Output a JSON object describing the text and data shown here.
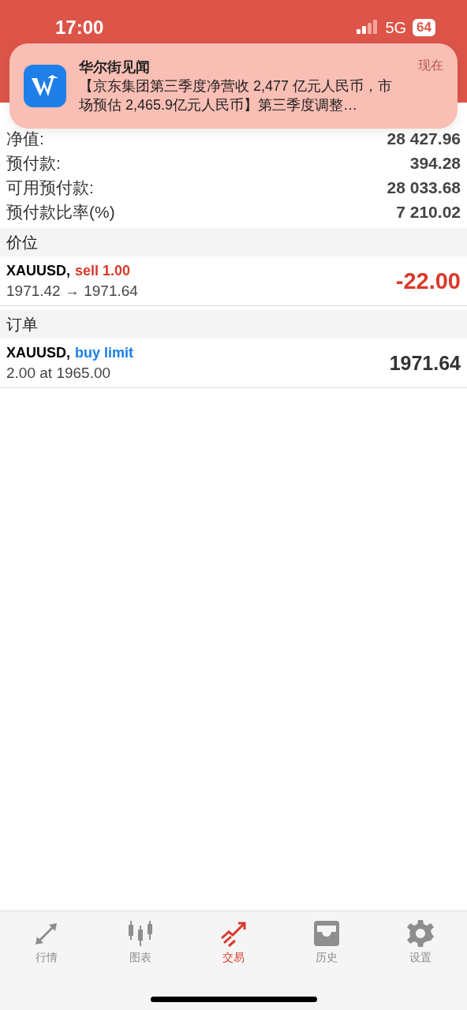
{
  "status_bar": {
    "time": "17:00",
    "network": "5G",
    "battery": "64"
  },
  "notification": {
    "app": "华尔街见闻",
    "time": "现在",
    "message": "【京东集团第三季度净营收 2,477 亿元人民币，市场预估 2,465.9亿元人民币】第三季度调整…"
  },
  "account": [
    {
      "label": "净值:",
      "value": "28 427.96"
    },
    {
      "label": "预付款:",
      "value": "394.28"
    },
    {
      "label": "可用预付款:",
      "value": "28 033.68"
    },
    {
      "label": "预付款比率(%)",
      "value": "7 210.02"
    }
  ],
  "sections": [
    {
      "title": "价位",
      "items": [
        {
          "symbol": "XAUUSD,",
          "action": {
            "text": "sell 1.00",
            "color": "#d9392b"
          },
          "detail": "1971.42 → 1971.64",
          "value": {
            "text": "-22.00",
            "color": "#d9392b"
          }
        }
      ]
    },
    {
      "title": "订单",
      "items": [
        {
          "symbol": "XAUUSD,",
          "action": {
            "text": "buy limit",
            "color": "#1a7ee6"
          },
          "detail": "2.00 at 1965.00",
          "value": {
            "text": "1971.64",
            "color": "#333333"
          }
        }
      ]
    }
  ],
  "tabs": [
    {
      "label": "行情",
      "kind": "quotes",
      "selected": false
    },
    {
      "label": "图表",
      "kind": "chart",
      "selected": false
    },
    {
      "label": "交易",
      "kind": "trade",
      "selected": true
    },
    {
      "label": "历史",
      "kind": "history",
      "selected": false
    },
    {
      "label": "设置",
      "kind": "settings",
      "selected": false
    }
  ]
}
